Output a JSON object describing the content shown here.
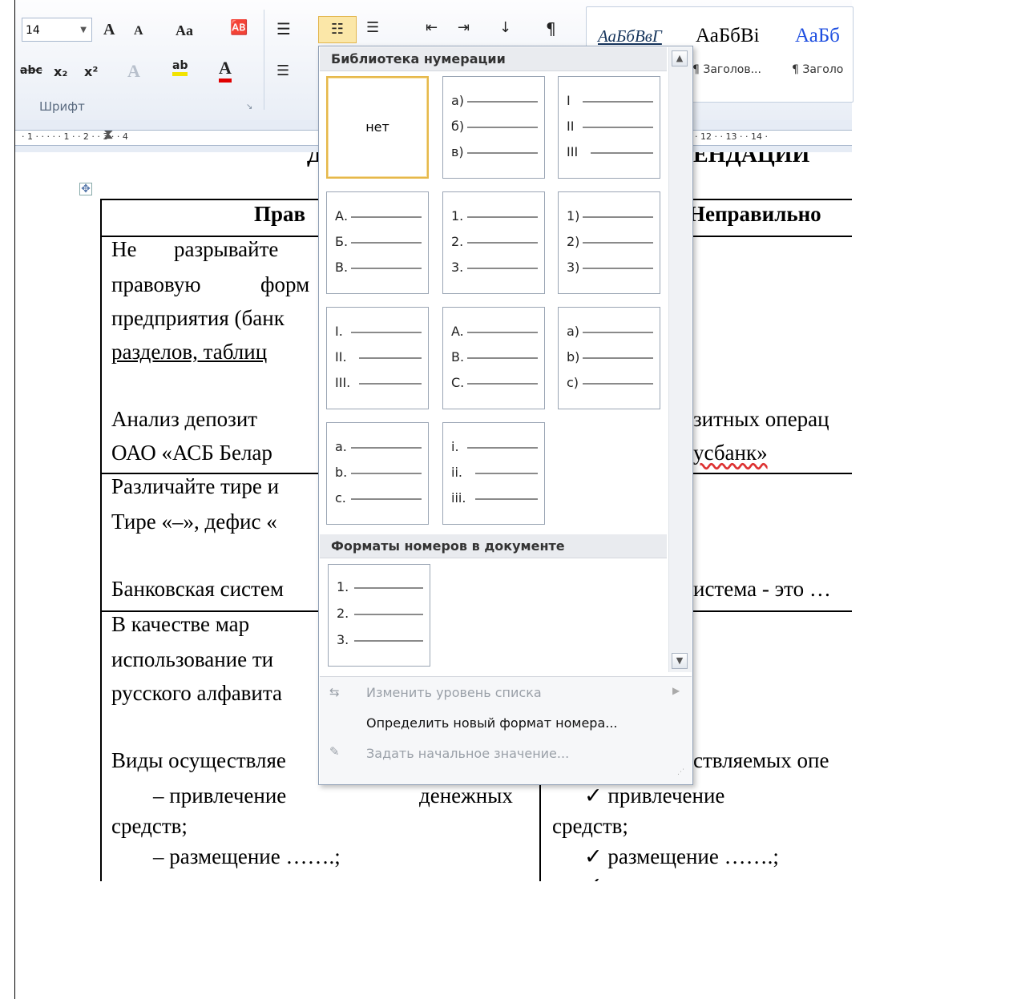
{
  "ribbon": {
    "font_size": "14",
    "font_group_label": "Шрифт",
    "styles": [
      {
        "sample": "АаБбВвГ",
        "name": ""
      },
      {
        "sample": "АаБбВі",
        "name": "¶ Заголов..."
      },
      {
        "sample": "АаБб",
        "name": "¶ Заголо"
      }
    ],
    "icons": {
      "grow": "A",
      "shrink": "A",
      "case": "Aa",
      "strike": "abc",
      "sub": "x₂",
      "sup": "x²",
      "highlight": "ab",
      "fontcolor": "A",
      "pilcrow": "¶"
    }
  },
  "ruler": {
    "marks": "· 1 ·  ·  ·  ·  · 1 ·  · 2 ·  · 3 ·  · 4",
    "marks_right": "· 12 ·  · 13 ·  · 14 ·"
  },
  "document": {
    "heading_left": "Д",
    "heading_right": "ЕНДАЦИИ",
    "col_right_header": "Неправильно",
    "col_left_header": "Прав",
    "rows": [
      [
        "Не",
        "разрывайте"
      ],
      [
        "правовую",
        "форм"
      ],
      [
        "предприятия (банк"
      ],
      [
        "разделов, таблиц"
      ]
    ],
    "anal_left": "Анализ   депозит",
    "anal_right": "зитных операц",
    "oao_left": "ОАО «АСБ Белар",
    "oao_right": "усбанк»",
    "diff": "Различайте тире и",
    "tire": "Тире «–», дефис «",
    "bank_left": "Банковская систем",
    "bank_right": "истема - это …",
    "vkach": "В   качестве   мар",
    "isp": "использование   ти",
    "rus": "русского алфавита",
    "vidy_left": "Виды осуществляе",
    "vidy_right": "ствляемых опе",
    "prv_left": "–  привлечение",
    "den": "денежных",
    "prv_right": "✓ привлечение",
    "sredstv": "средств;",
    "razm_left": "–  размещение …….;",
    "razm_right": "✓ размещение …….;",
    "otkr": "✓ открытие и ведение"
  },
  "menu": {
    "library_title": "Библиотека нумерации",
    "doc_formats_title": "Форматы номеров в документе",
    "none_label": "нет",
    "tiles": [
      [
        "а)",
        "б)",
        "в)"
      ],
      [
        "I",
        "II",
        "III"
      ],
      [
        "А.",
        "Б.",
        "В."
      ],
      [
        "1.",
        "2.",
        "3."
      ],
      [
        "1)",
        "2)",
        "3)"
      ],
      [
        "I.",
        "II.",
        "III."
      ],
      [
        "A.",
        "B.",
        "C."
      ],
      [
        "a)",
        "b)",
        "c)"
      ],
      [
        "a.",
        "b.",
        "c."
      ],
      [
        "i.",
        "ii.",
        "iii."
      ]
    ],
    "doc_tile": [
      "1.",
      "2.",
      "3."
    ],
    "change_level": "Изменить уровень списка",
    "define_new": "Определить новый формат номера...",
    "set_start": "Задать начальное значение..."
  }
}
